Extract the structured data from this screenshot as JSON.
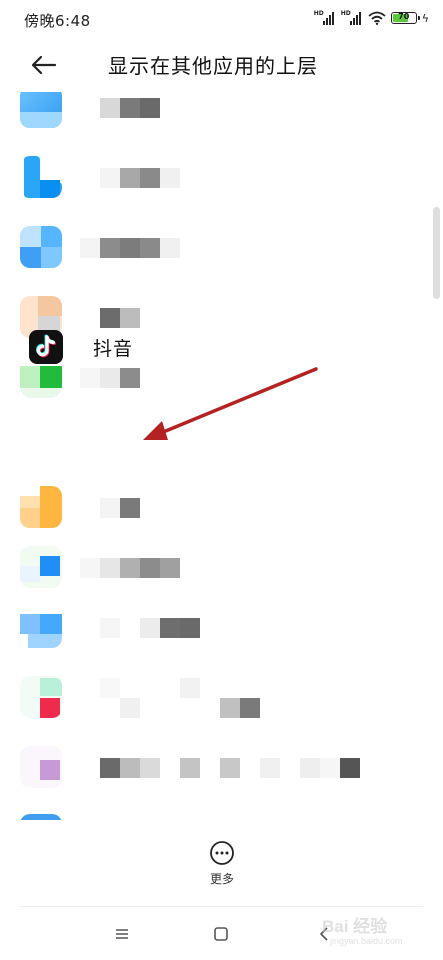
{
  "status_bar": {
    "time": "傍晚6:48",
    "signal_1_label": "HD",
    "signal_2_label": "HD",
    "battery_level": "70",
    "icons": [
      "signal-icon",
      "signal-icon",
      "wifi-icon",
      "battery-icon",
      "charging-icon"
    ]
  },
  "header": {
    "back_icon": "back-arrow-icon",
    "title": "显示在其他应用的上层"
  },
  "app_list": {
    "highlighted_app": {
      "name": "抖音",
      "icon": "tiktok-icon"
    },
    "blurred_app_count": 11
  },
  "annotation": {
    "arrow_color": "#b52222"
  },
  "footer": {
    "more_icon": "more-dots-icon",
    "more_label": "更多"
  },
  "nav_bar": {
    "icons": [
      "menu-icon",
      "home-icon",
      "back-icon"
    ]
  },
  "watermark": {
    "text": "Bai 经验",
    "sub": "jingyan.baidu.com"
  },
  "colors": {
    "tiktok_bg": "#111111",
    "tiktok_cyan": "#25f4ee",
    "tiktok_red": "#fe2c55"
  }
}
